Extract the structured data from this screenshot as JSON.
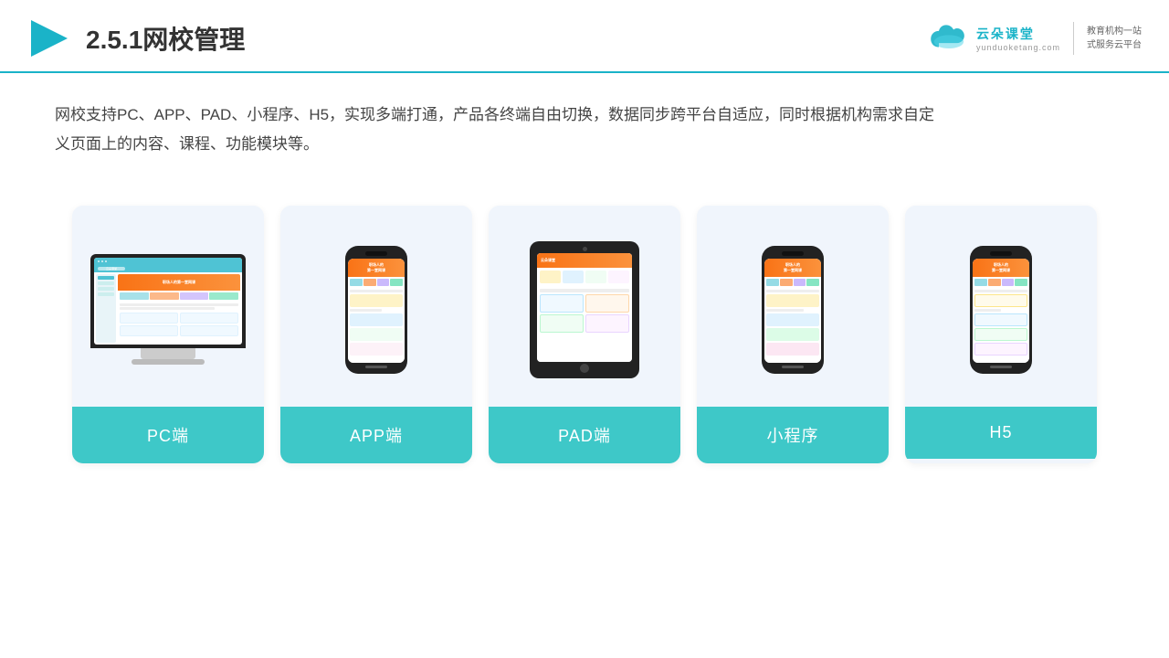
{
  "header": {
    "title": "2.5.1网校管理",
    "logo_name": "云朵课堂",
    "logo_domain": "yunduoketang.com",
    "logo_slogan": "教育机构一站\n式服务云平台"
  },
  "description": {
    "text": "网校支持PC、APP、PAD、小程序、H5，实现多端打通，产品各终端自由切换，数据同步跨平台自适应，同时根据机构需求自定义页面上的内容、课程、功能模块等。"
  },
  "cards": [
    {
      "id": "pc",
      "label": "PC端"
    },
    {
      "id": "app",
      "label": "APP端"
    },
    {
      "id": "pad",
      "label": "PAD端"
    },
    {
      "id": "miniprogram",
      "label": "小程序"
    },
    {
      "id": "h5",
      "label": "H5"
    }
  ]
}
